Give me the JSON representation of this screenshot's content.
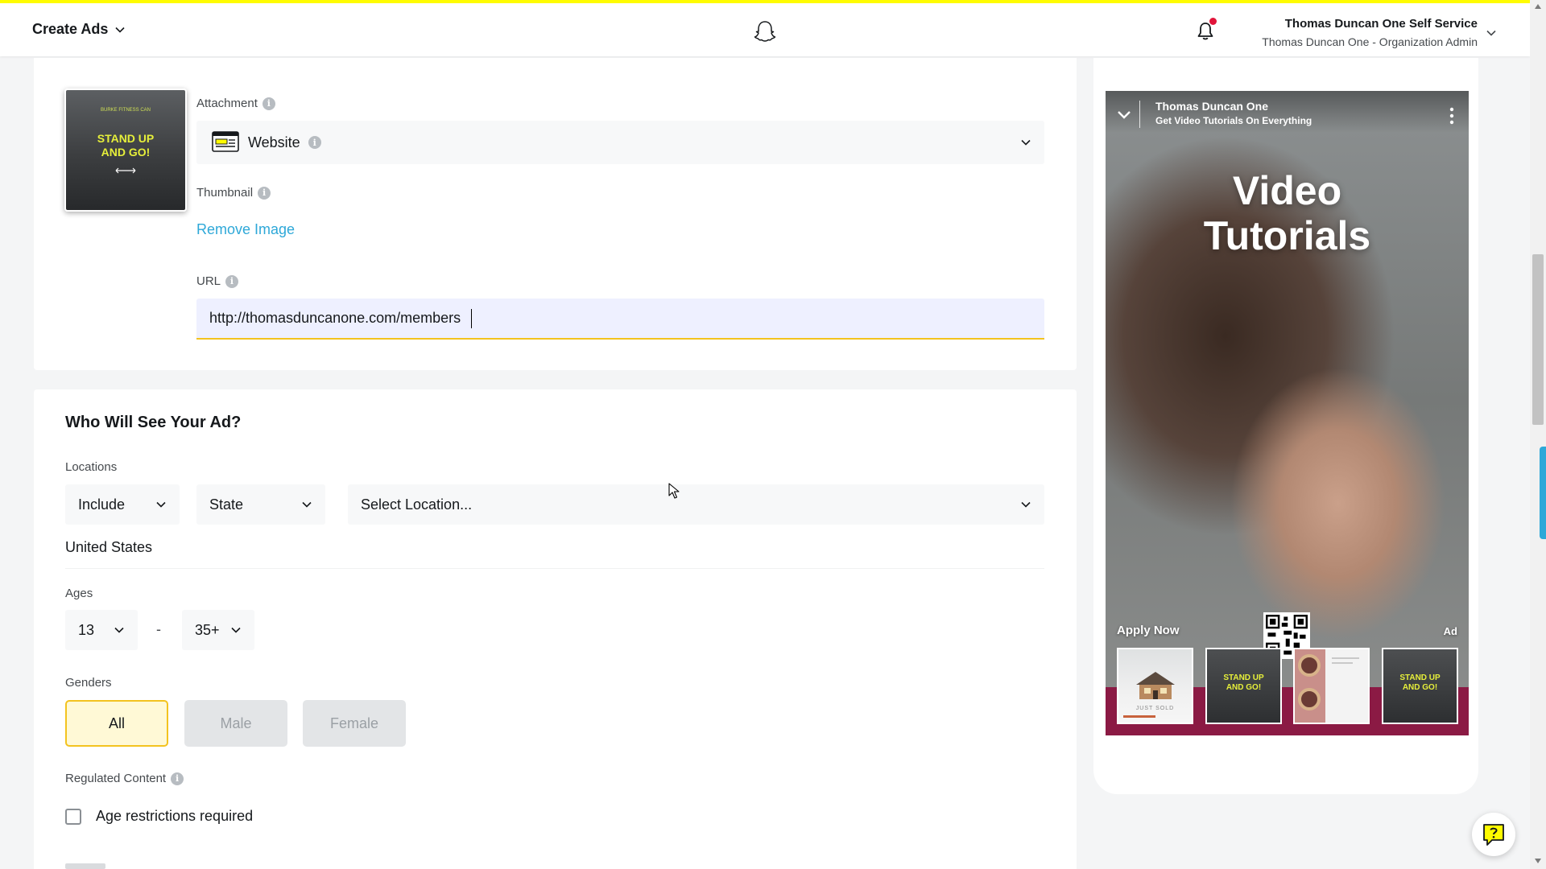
{
  "header": {
    "app_menu_label": "Create Ads",
    "account_name": "Thomas Duncan One Self Service",
    "account_role": "Thomas Duncan One - Organization Admin",
    "icons": [
      "ghost-logo-icon",
      "bell-icon",
      "chevron-down-icon"
    ]
  },
  "attachment": {
    "thumbnail_text": {
      "small_top": "BURKE FITNESS CAN",
      "headline_line1": "STAND UP",
      "headline_line2": "AND GO!"
    },
    "attachment_label": "Attachment",
    "attachment_value": "Website",
    "thumbnail_label": "Thumbnail",
    "remove_image_label": "Remove Image",
    "url_label": "URL",
    "url_value": "http://thomasduncanone.com/members"
  },
  "audience": {
    "title": "Who Will See Your Ad?",
    "locations_label": "Locations",
    "include_value": "Include",
    "region_type_value": "State",
    "location_placeholder": "Select Location...",
    "selected_country": "United States",
    "ages_label": "Ages",
    "age_min": "13",
    "age_separator": "-",
    "age_max": "35+",
    "genders_label": "Genders",
    "genders": [
      "All",
      "Male",
      "Female"
    ],
    "selected_gender": "All",
    "regulated_label": "Regulated Content",
    "age_restriction_label": "Age restrictions required",
    "age_restriction_checked": false
  },
  "preview": {
    "brand_name": "Thomas Duncan One",
    "headline_text": "Get Video Tutorials On Everything",
    "overlay_line1": "Video",
    "overlay_line2": "Tutorials",
    "cta": "Apply Now",
    "ad_badge": "Ad",
    "tile_just_sold": "JUST SOLD",
    "tile_sgo_line1": "STAND UP",
    "tile_sgo_line2": "AND GO!"
  },
  "colors": {
    "accent_yellow": "#fffc00",
    "link_blue": "#2ea8d8",
    "focus_border": "#f3c31f",
    "notification_red": "#e1143a",
    "attachment_band": "#8b1a44"
  }
}
